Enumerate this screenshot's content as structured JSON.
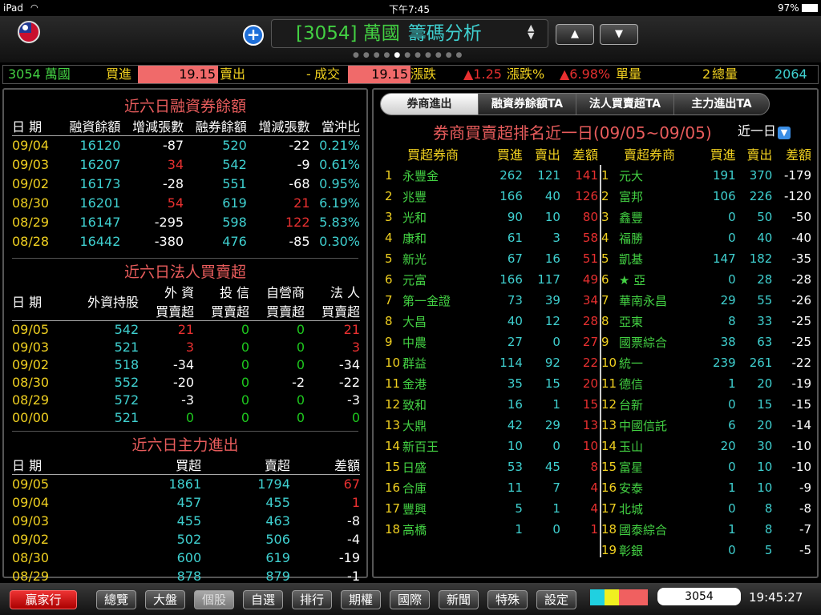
{
  "status": {
    "device": "iPad",
    "time": "下午7:45",
    "battery": "97%"
  },
  "header": {
    "code": "[3054] 萬國",
    "title": "籌碼分析",
    "up": "▲",
    "down": "▼"
  },
  "quote": {
    "name": "3054 萬國",
    "buy_label": "買進",
    "buy": "19.15",
    "sell_label": "賣出",
    "sell": "-",
    "deal_label": "成交",
    "deal": "19.15",
    "chg_label": "漲跌",
    "chg": "▲1.25",
    "pct_label": "漲跌%",
    "pct": "▲6.98%",
    "vol_label": "單量",
    "vol": "2",
    "tot_label": "總量",
    "tot": "2064"
  },
  "margin": {
    "title": "近六日融資券餘額",
    "headers": [
      "日 期",
      "融資餘額",
      "增減張數",
      "融券餘額",
      "增減張數",
      "當沖比"
    ],
    "rows": [
      [
        "09/04",
        "16120",
        "-87",
        "520",
        "-22",
        "0.21%"
      ],
      [
        "09/03",
        "16207",
        "34",
        "542",
        "-9",
        "0.61%"
      ],
      [
        "09/02",
        "16173",
        "-28",
        "551",
        "-68",
        "0.95%"
      ],
      [
        "08/30",
        "16201",
        "54",
        "619",
        "21",
        "6.19%"
      ],
      [
        "08/29",
        "16147",
        "-295",
        "598",
        "122",
        "5.83%"
      ],
      [
        "08/28",
        "16442",
        "-380",
        "476",
        "-85",
        "0.30%"
      ]
    ]
  },
  "inst": {
    "title": "近六日法人買賣超",
    "h_date": "日 期",
    "h_hold": "外資持股",
    "h_top": [
      "外 資",
      "投 信",
      "自營商",
      "法 人"
    ],
    "h_bot": [
      "買賣超",
      "買賣超",
      "買賣超",
      "買賣超"
    ],
    "rows": [
      [
        "09/05",
        "542",
        "21",
        "0",
        "0",
        "21"
      ],
      [
        "09/03",
        "521",
        "3",
        "0",
        "0",
        "3"
      ],
      [
        "09/02",
        "518",
        "-34",
        "0",
        "0",
        "-34"
      ],
      [
        "08/30",
        "552",
        "-20",
        "0",
        "-2",
        "-22"
      ],
      [
        "08/29",
        "572",
        "-3",
        "0",
        "0",
        "-3"
      ],
      [
        "00/00",
        "521",
        "0",
        "0",
        "0",
        "0"
      ]
    ]
  },
  "main": {
    "title": "近六日主力進出",
    "headers": [
      "日 期",
      "買超",
      "賣超",
      "差額"
    ],
    "rows": [
      [
        "09/05",
        "1861",
        "1794",
        "67"
      ],
      [
        "09/04",
        "457",
        "455",
        "1"
      ],
      [
        "09/03",
        "455",
        "463",
        "-8"
      ],
      [
        "09/02",
        "502",
        "506",
        "-4"
      ],
      [
        "08/30",
        "600",
        "619",
        "-19"
      ],
      [
        "08/29",
        "878",
        "879",
        "-1"
      ]
    ]
  },
  "tabs": [
    "券商進出",
    "融資券餘額TA",
    "法人買賣超TA",
    "主力進出TA"
  ],
  "broker": {
    "title": "券商買賣超排名近一日(09/05~09/05)",
    "period": "近一日",
    "buy_headers": [
      "買超券商",
      "買進",
      "賣出",
      "差額"
    ],
    "sell_headers": [
      "賣超券商",
      "買進",
      "賣出",
      "差額"
    ],
    "buy_rows": [
      [
        "1",
        "永豐金",
        "262",
        "121",
        "141"
      ],
      [
        "2",
        "兆豐",
        "166",
        "40",
        "126"
      ],
      [
        "3",
        "光和",
        "90",
        "10",
        "80"
      ],
      [
        "4",
        "康和",
        "61",
        "3",
        "58"
      ],
      [
        "5",
        "新光",
        "67",
        "16",
        "51"
      ],
      [
        "6",
        "元富",
        "166",
        "117",
        "49"
      ],
      [
        "7",
        "第一金證",
        "73",
        "39",
        "34"
      ],
      [
        "8",
        "大昌",
        "40",
        "12",
        "28"
      ],
      [
        "9",
        "中農",
        "27",
        "0",
        "27"
      ],
      [
        "10",
        "群益",
        "114",
        "92",
        "22"
      ],
      [
        "11",
        "金港",
        "35",
        "15",
        "20"
      ],
      [
        "12",
        "致和",
        "16",
        "1",
        "15"
      ],
      [
        "13",
        "大鼎",
        "42",
        "29",
        "13"
      ],
      [
        "14",
        "新百王",
        "10",
        "0",
        "10"
      ],
      [
        "15",
        "日盛",
        "53",
        "45",
        "8"
      ],
      [
        "16",
        "合庫",
        "11",
        "7",
        "4"
      ],
      [
        "17",
        "豐興",
        "5",
        "1",
        "4"
      ],
      [
        "18",
        "高橋",
        "1",
        "0",
        "1"
      ]
    ],
    "sell_rows": [
      [
        "1",
        "元大",
        "191",
        "370",
        "-179"
      ],
      [
        "2",
        "富邦",
        "106",
        "226",
        "-120"
      ],
      [
        "3",
        "鑫豐",
        "0",
        "50",
        "-50"
      ],
      [
        "4",
        "福勝",
        "0",
        "40",
        "-40"
      ],
      [
        "5",
        "凱基",
        "147",
        "182",
        "-35"
      ],
      [
        "6",
        "★ 亞",
        "0",
        "28",
        "-28"
      ],
      [
        "7",
        "華南永昌",
        "29",
        "55",
        "-26"
      ],
      [
        "8",
        "亞東",
        "8",
        "33",
        "-25"
      ],
      [
        "9",
        "國票綜合",
        "38",
        "63",
        "-25"
      ],
      [
        "10",
        "統一",
        "239",
        "261",
        "-22"
      ],
      [
        "11",
        "德信",
        "1",
        "20",
        "-19"
      ],
      [
        "12",
        "台新",
        "0",
        "15",
        "-15"
      ],
      [
        "13",
        "中國信託",
        "6",
        "20",
        "-14"
      ],
      [
        "14",
        "玉山",
        "20",
        "30",
        "-10"
      ],
      [
        "15",
        "富星",
        "0",
        "10",
        "-10"
      ],
      [
        "16",
        "安泰",
        "1",
        "10",
        "-9"
      ],
      [
        "17",
        "北城",
        "0",
        "8",
        "-8"
      ],
      [
        "18",
        "國泰綜合",
        "1",
        "8",
        "-7"
      ],
      [
        "19",
        "彰銀",
        "0",
        "5",
        "-5"
      ]
    ]
  },
  "bottom": {
    "brand": "贏家行",
    "buttons": [
      "總覽",
      "大盤",
      "個股",
      "自選",
      "排行",
      "期權",
      "國際",
      "新聞",
      "特殊",
      "設定"
    ],
    "search": "3054",
    "clock": "19:45:27",
    "selected": "個股"
  }
}
